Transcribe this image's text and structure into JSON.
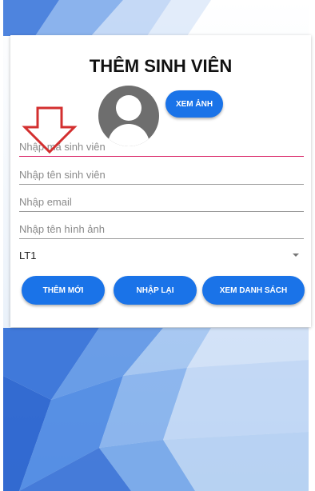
{
  "form": {
    "title": "THÊM SINH VIÊN",
    "view_image_label": "XEM ẢNH",
    "fields": [
      {
        "placeholder": "Nhập mã sinh viên",
        "value": ""
      },
      {
        "placeholder": "Nhập tên sinh viên",
        "value": ""
      },
      {
        "placeholder": "Nhập email",
        "value": ""
      },
      {
        "placeholder": "Nhập tên hình ảnh",
        "value": ""
      }
    ],
    "class_select": {
      "selected": "LT1"
    },
    "buttons": {
      "add": "THÊM MỚI",
      "reset": "NHẬP LẠI",
      "view_list": "XEM DANH SÁCH"
    }
  },
  "colors": {
    "primary": "#1a73e8",
    "focus_underline": "#d81b60",
    "annotation_arrow": "#d32f2f",
    "avatar": "#6e6e6e"
  },
  "icons": {
    "avatar": "person-placeholder-icon",
    "dropdown": "triangle-down-icon",
    "annotation": "down-arrow-outline-icon"
  }
}
